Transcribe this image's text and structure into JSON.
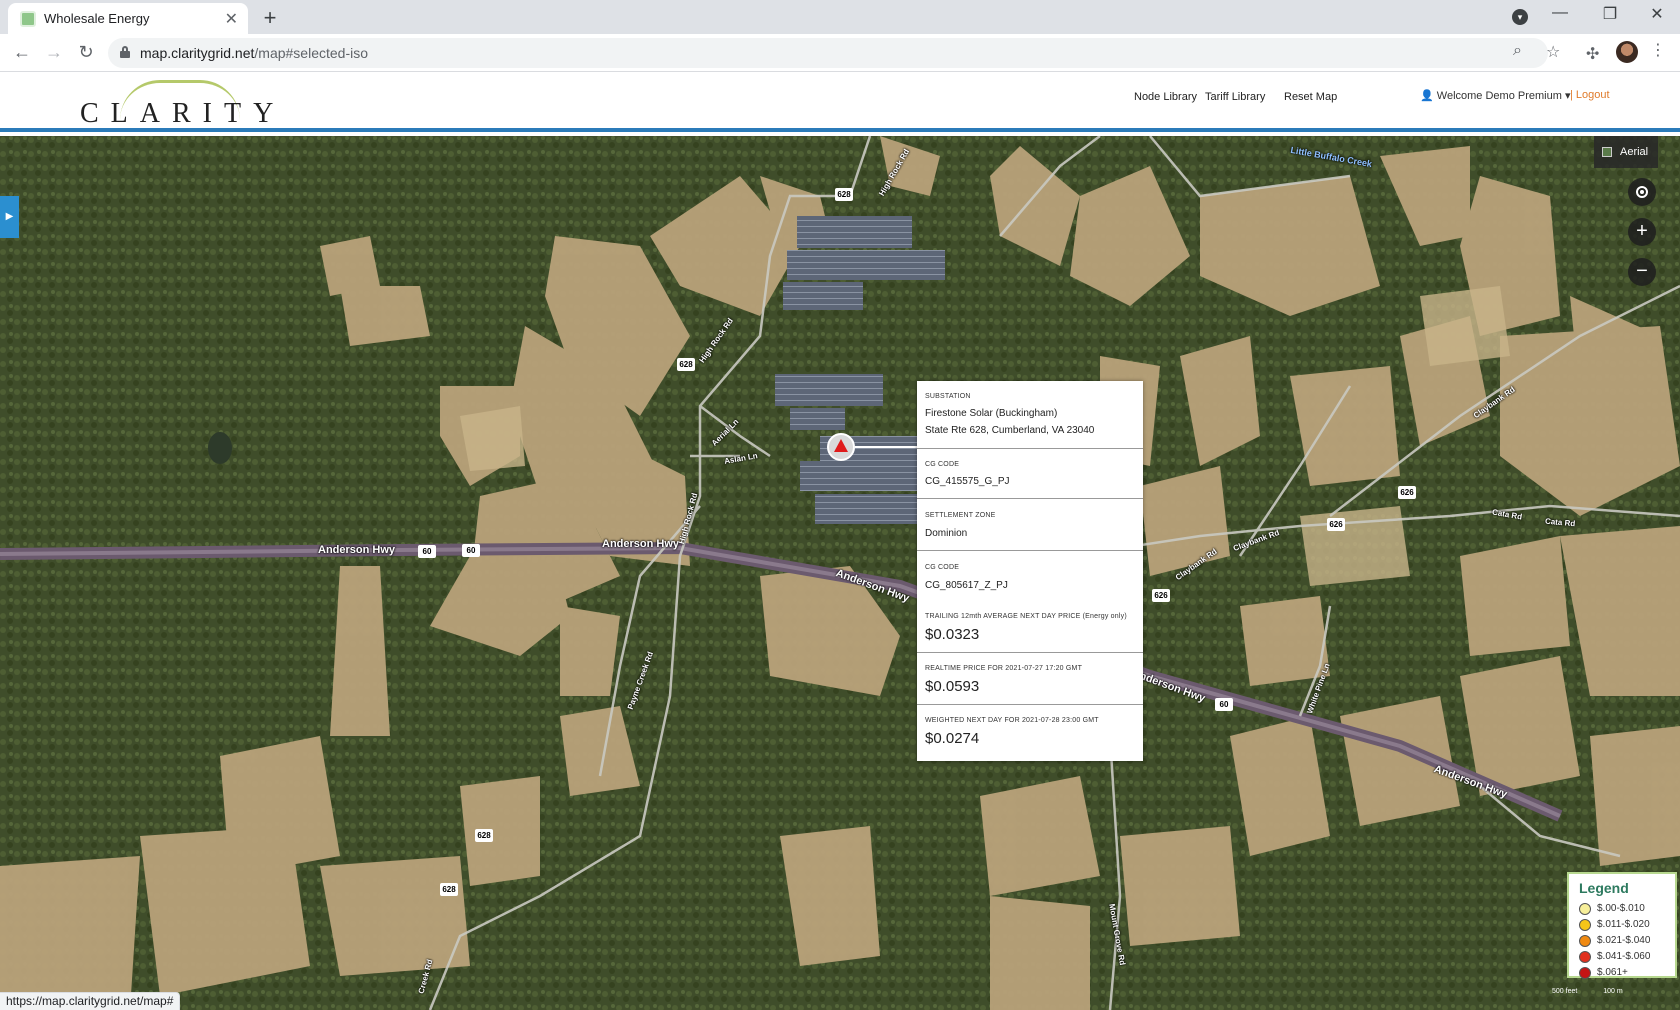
{
  "browser": {
    "tab_title": "Wholesale Energy",
    "url_host": "map.claritygrid.net",
    "url_path": "/map#selected-iso",
    "status_url": "https://map.claritygrid.net/map#"
  },
  "header": {
    "logo_text": "CLARITY",
    "nav": [
      "Node Library",
      "Tariff Library",
      "Reset Map"
    ],
    "user_label": "Welcome Demo Premium",
    "logout_label": "| Logout"
  },
  "map": {
    "layer_button": "Aerial",
    "zoom_in": "+",
    "zoom_out": "−",
    "roads": {
      "anderson_hwy_1": "Anderson Hwy",
      "anderson_hwy_2": "Anderson Hwy",
      "anderson_hwy_3": "Anderson Hwy",
      "anderson_hwy_4": "Anderson Hwy",
      "anderson_hwy_5": "Anderson Hwy",
      "high_rock_rd_1": "High Rock Rd",
      "high_rock_rd_2": "High Rock Rd",
      "high_rock_rd_3": "High Rock Rd",
      "aerial_ln": "Aerial Ln",
      "aslan_ln": "Aslan Ln",
      "payne_creek_rd": "Payne Creek Rd",
      "claybank_rd_1": "Claybank Rd",
      "claybank_rd_2": "Claybank Rd",
      "claybank_rd_3": "Claybank Rd",
      "cata_rd_1": "Cata Rd",
      "cata_rd_2": "Cata Rd",
      "little_buffalo_creek": "Little Buffalo Creek",
      "white_pine_ln": "White Pine Ln",
      "mount_grove_rd": "Mount Grove Rd",
      "creek_rd": "Creek Rd"
    },
    "shields": [
      "628",
      "628",
      "60",
      "60",
      "626",
      "626",
      "626",
      "60",
      "628",
      "628"
    ],
    "scale": {
      "left": "500 feet",
      "right": "100 m"
    }
  },
  "popup": {
    "substation_label": "SUBSTATION",
    "substation_name": "Firestone Solar (Buckingham)",
    "substation_address": "State Rte 628, Cumberland, VA 23040",
    "cg_code_label_1": "CG CODE",
    "cg_code_1": "CG_415575_G_PJ",
    "zone_label": "SETTLEMENT ZONE",
    "zone": "Dominion",
    "cg_code_label_2": "CG CODE",
    "cg_code_2": "CG_805617_Z_PJ",
    "trailing_label": "TRAILING 12mth AVERAGE NEXT DAY PRICE (Energy only)",
    "trailing_price": "$0.0323",
    "realtime_label": "REALTIME PRICE FOR 2021-07-27 17:20 GMT",
    "realtime_price": "$0.0593",
    "weighted_label": "WEIGHTED NEXT DAY FOR 2021-07-28 23:00 GMT",
    "weighted_price": "$0.0274"
  },
  "legend": {
    "title": "Legend",
    "items": [
      {
        "label": "$.00-$.010",
        "color": "#f7ef9a"
      },
      {
        "label": "$.011-$.020",
        "color": "#f5c518"
      },
      {
        "label": "$.021-$.040",
        "color": "#f08a12"
      },
      {
        "label": "$.041-$.060",
        "color": "#e0301e"
      },
      {
        "label": "$.061+",
        "color": "#c41414"
      }
    ]
  }
}
